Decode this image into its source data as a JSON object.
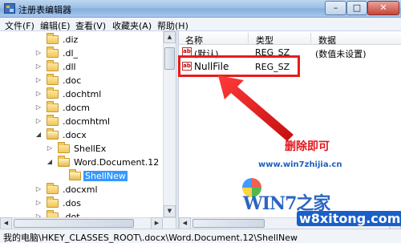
{
  "window": {
    "title": "注册表编辑器",
    "minimize": "–",
    "maximize": "□",
    "close": "✕"
  },
  "menu": [
    "文件(F)",
    "编辑(E)",
    "查看(V)",
    "收藏夹(A)",
    "帮助(H)"
  ],
  "tree": [
    {
      "label": ".diz",
      "expander": "",
      "open": false,
      "selected": false
    },
    {
      "label": ".dl_",
      "expander": "▷",
      "open": false,
      "selected": false
    },
    {
      "label": ".dll",
      "expander": "▷",
      "open": false,
      "selected": false
    },
    {
      "label": ".doc",
      "expander": "▷",
      "open": false,
      "selected": false
    },
    {
      "label": ".dochtml",
      "expander": "▷",
      "open": false,
      "selected": false
    },
    {
      "label": ".docm",
      "expander": "▷",
      "open": false,
      "selected": false
    },
    {
      "label": ".docmhtml",
      "expander": "▷",
      "open": false,
      "selected": false
    },
    {
      "label": ".docx",
      "expander": "◢",
      "open": true,
      "selected": false
    },
    {
      "label": "ShellEx",
      "expander": "▷",
      "open": false,
      "selected": false
    },
    {
      "label": "Word.Document.12",
      "expander": "◢",
      "open": true,
      "selected": false
    },
    {
      "label": "ShellNew",
      "expander": "",
      "open": true,
      "selected": true
    },
    {
      "label": ".docxml",
      "expander": "▷",
      "open": false,
      "selected": false
    },
    {
      "label": ".dos",
      "expander": "▷",
      "open": false,
      "selected": false
    },
    {
      "label": ".dot",
      "expander": "▷",
      "open": false,
      "selected": false
    }
  ],
  "list": {
    "headers": {
      "name": "名称",
      "type": "类型",
      "data": "数据"
    },
    "rows": [
      {
        "name": "(默认)",
        "type": "REG_SZ",
        "data": "(数值未设置)",
        "icon": "ab"
      },
      {
        "name": "NullFile",
        "type": "REG_SZ",
        "data": "",
        "icon": "ab"
      }
    ]
  },
  "annotation": {
    "text": "删除即可",
    "color": "#e4161c"
  },
  "watermark": {
    "url": "www.win7zhijia.cn",
    "logo": "WIN7之家",
    "site": "w8xitong.com"
  },
  "statusbar": {
    "path": "我的电脑\\HKEY_CLASSES_ROOT\\.docx\\Word.Document.12\\ShellNew"
  }
}
